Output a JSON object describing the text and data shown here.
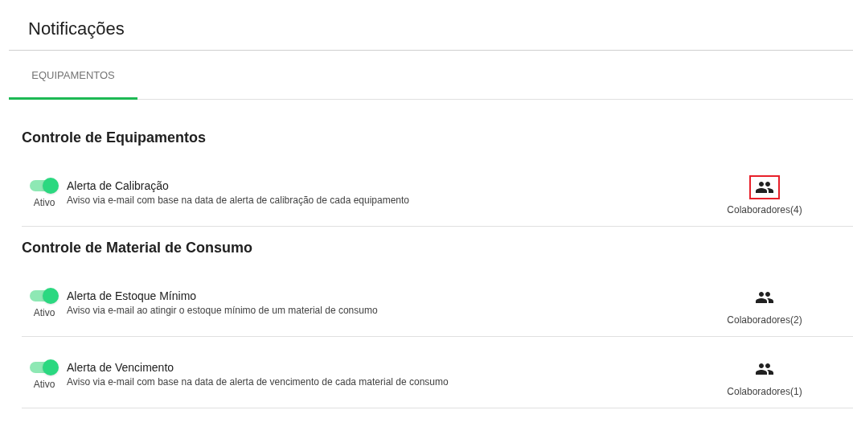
{
  "page_title": "Notificações",
  "tabs": [
    {
      "label": "EQUIPAMENTOS",
      "selected": true
    }
  ],
  "sections": [
    {
      "heading": "Controle de Equipamentos",
      "rows": [
        {
          "title": "Alerta de Calibração",
          "description": "Aviso via e-mail com base na data de alerta de calibração de cada equipamento",
          "on": true,
          "toggle_label": "Ativo",
          "collaborators": "Colaboradores(4)",
          "highlighted": true
        }
      ]
    },
    {
      "heading": "Controle de Material de Consumo",
      "rows": [
        {
          "title": "Alerta de Estoque Mínimo",
          "description": "Aviso via e-mail ao atingir o estoque mínimo de um material de consumo",
          "on": true,
          "toggle_label": "Ativo",
          "collaborators": "Colaboradores(2)",
          "highlighted": false
        },
        {
          "title": "Alerta de Vencimento",
          "description": "Aviso via e-mail com base na data de alerta de vencimento de cada material de consumo",
          "on": true,
          "toggle_label": "Ativo",
          "collaborators": "Colaboradores(1)",
          "highlighted": false
        }
      ]
    }
  ]
}
